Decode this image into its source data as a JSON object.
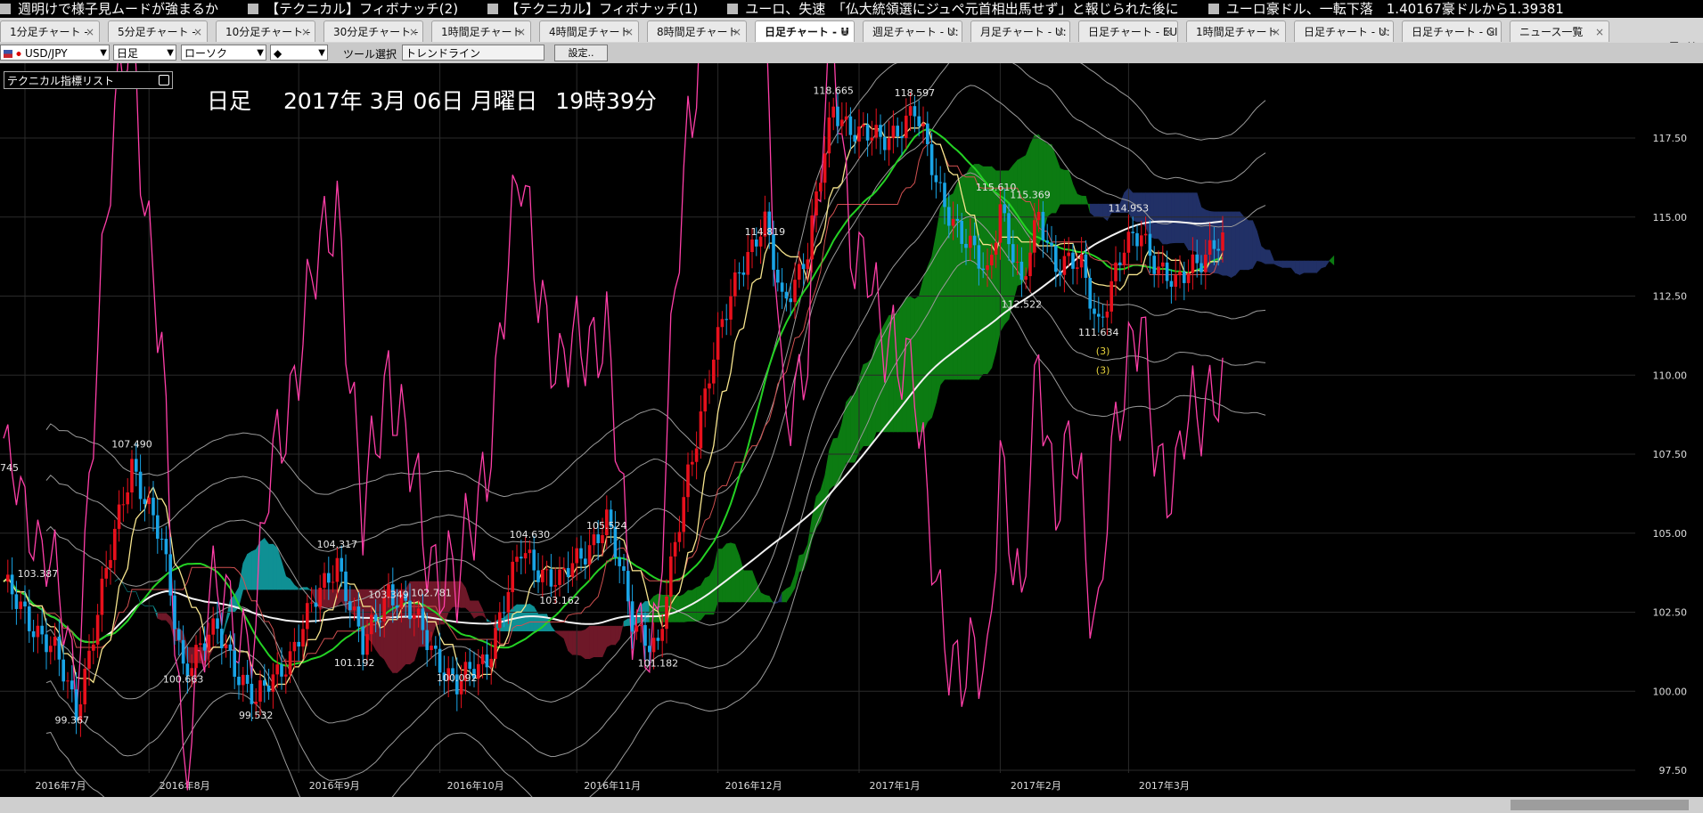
{
  "ticker": [
    "週明けで様子見ムードが強まるか",
    "【テクニカル】フィボナッチ(2)",
    "【テクニカル】フィボナッチ(1)",
    "ユーロ、失速　「仏大統領選にジュペ元首相出馬せず」と報じられた後に",
    "ユーロ豪ドル、一転下落　1.40167豪ドルから1.39381"
  ],
  "tabs": [
    {
      "label": "1分足チャート - ",
      "active": false
    },
    {
      "label": "5分足チャート - ",
      "active": false
    },
    {
      "label": "10分足チャート - ",
      "active": false
    },
    {
      "label": "30分足チャート - ",
      "active": false
    },
    {
      "label": "1時間足チャート",
      "active": false
    },
    {
      "label": "4時間足チャート",
      "active": false
    },
    {
      "label": "8時間足チャート",
      "active": false
    },
    {
      "label": "日足チャート - U",
      "active": true
    },
    {
      "label": "週足チャート - U:",
      "active": false
    },
    {
      "label": "月足チャート - U:",
      "active": false
    },
    {
      "label": "日足チャート - EU",
      "active": false
    },
    {
      "label": "1時間足チャート",
      "active": false
    },
    {
      "label": "日足チャート - U:",
      "active": false
    },
    {
      "label": "日足チャート - GI",
      "active": false
    },
    {
      "label": "ニュース一覧",
      "active": false
    }
  ],
  "tab_controls": {
    "menu": "▼",
    "close": "✕"
  },
  "toolbar": {
    "pair": "USD/JPY",
    "period": "日足",
    "chart_type": "ローソク",
    "style_symbol": "◆",
    "tool_label": "ツール選択",
    "tool_value": "トレンドライン",
    "settings_label": "設定..",
    "dropdown_icon": "chevron-down-icon"
  },
  "indicator_list": {
    "label": "テクニカル指標リスト"
  },
  "chart_header": {
    "period": "日足",
    "date": "2017年 3月 06日 月曜日",
    "time": "19時39分"
  },
  "chart_data": {
    "type": "candlestick",
    "title": "",
    "xlabel": "",
    "ylabel": "",
    "ylim": [
      97.5,
      118.3
    ],
    "y_ticks": [
      "117.50",
      "115.00",
      "112.50",
      "110.00",
      "107.50",
      "105.00",
      "102.50",
      "100.00",
      "97.50"
    ],
    "x_ticks": [
      "2016年7月",
      "2016年8月",
      "2016年9月",
      "2016年10月",
      "2016年11月",
      "2016年12月",
      "2017年1月",
      "2017年2月",
      "2017年3月"
    ],
    "price_labels": [
      {
        "text": "118.665",
        "day": 194,
        "price": 118.665
      },
      {
        "text": "118.597",
        "day": 213,
        "price": 118.597
      },
      {
        "text": "114.819",
        "day": 178,
        "price": 114.819
      },
      {
        "text": "115.610",
        "day": 232,
        "price": 115.61
      },
      {
        "text": "115.369",
        "day": 240,
        "price": 115.369
      },
      {
        "text": "114.953",
        "day": 263,
        "price": 114.953
      },
      {
        "text": "112.522",
        "day": 238,
        "price": 112.522
      },
      {
        "text": "111.634",
        "day": 256,
        "price": 111.634
      },
      {
        "text": "107.490",
        "day": 30,
        "price": 107.49
      },
      {
        "text": "105.524",
        "day": 141,
        "price": 105.524
      },
      {
        "text": "104.630",
        "day": 123,
        "price": 104.63
      },
      {
        "text": "104.317",
        "day": 78,
        "price": 104.317
      },
      {
        "text": "103.349",
        "day": 90,
        "price": 103.349
      },
      {
        "text": "103.162",
        "day": 130,
        "price": 103.162
      },
      {
        "text": "103.387",
        "day": 8,
        "price": 103.387
      },
      {
        "text": "102.781",
        "day": 100,
        "price": 102.781
      },
      {
        "text": "101.192",
        "day": 82,
        "price": 101.192
      },
      {
        "text": "101.182",
        "day": 153,
        "price": 101.182
      },
      {
        "text": "100.663",
        "day": 42,
        "price": 100.663
      },
      {
        "text": "100.092",
        "day": 106,
        "price": 100.092
      },
      {
        "text": "99.367",
        "day": 16,
        "price": 99.367
      },
      {
        "text": "99.532",
        "day": 59,
        "price": 99.532
      },
      {
        "text": ".745",
        "day": 1,
        "price": 106.745
      }
    ],
    "annotations": [
      {
        "text": "(3)",
        "day": 257,
        "price": 110.65
      },
      {
        "text": "(3)",
        "day": 257,
        "price": 110.05
      }
    ],
    "waypoints": [
      [
        0,
        103.3
      ],
      [
        5,
        102.5
      ],
      [
        12,
        101.2
      ],
      [
        17,
        99.4
      ],
      [
        22,
        102.5
      ],
      [
        30,
        107.3
      ],
      [
        37,
        104.6
      ],
      [
        42,
        100.8
      ],
      [
        50,
        101.9
      ],
      [
        59,
        99.6
      ],
      [
        67,
        101.2
      ],
      [
        78,
        104.2
      ],
      [
        84,
        101.3
      ],
      [
        90,
        103.3
      ],
      [
        97,
        102.1
      ],
      [
        106,
        100.1
      ],
      [
        113,
        101.1
      ],
      [
        121,
        104.4
      ],
      [
        130,
        103.4
      ],
      [
        141,
        105.4
      ],
      [
        147,
        102.3
      ],
      [
        153,
        101.3
      ],
      [
        160,
        107.0
      ],
      [
        166,
        110.5
      ],
      [
        172,
        113.5
      ],
      [
        178,
        114.7
      ],
      [
        182,
        112.3
      ],
      [
        188,
        113.9
      ],
      [
        194,
        118.5
      ],
      [
        200,
        117.6
      ],
      [
        205,
        117.4
      ],
      [
        213,
        118.3
      ],
      [
        218,
        116.2
      ],
      [
        224,
        114.3
      ],
      [
        230,
        113.2
      ],
      [
        233,
        115.5
      ],
      [
        238,
        112.6
      ],
      [
        242,
        115.2
      ],
      [
        246,
        113.5
      ],
      [
        252,
        113.4
      ],
      [
        256,
        111.7
      ],
      [
        262,
        113.9
      ],
      [
        266,
        114.6
      ],
      [
        270,
        113.4
      ],
      [
        274,
        112.7
      ],
      [
        278,
        113.6
      ],
      [
        283,
        114.1
      ]
    ]
  },
  "colors": {
    "up": "#e8101c",
    "down": "#19a4e6",
    "cloud_blue": "#213066",
    "cloud_green": "#0c7b12",
    "cloud_teal": "#0f9094",
    "cloud_maroon": "#6e1828",
    "rsi": "#ff3fa8",
    "ma_green": "#24d224",
    "ma_white": "#f2f2f2",
    "tenkan": "#f7e58e"
  }
}
